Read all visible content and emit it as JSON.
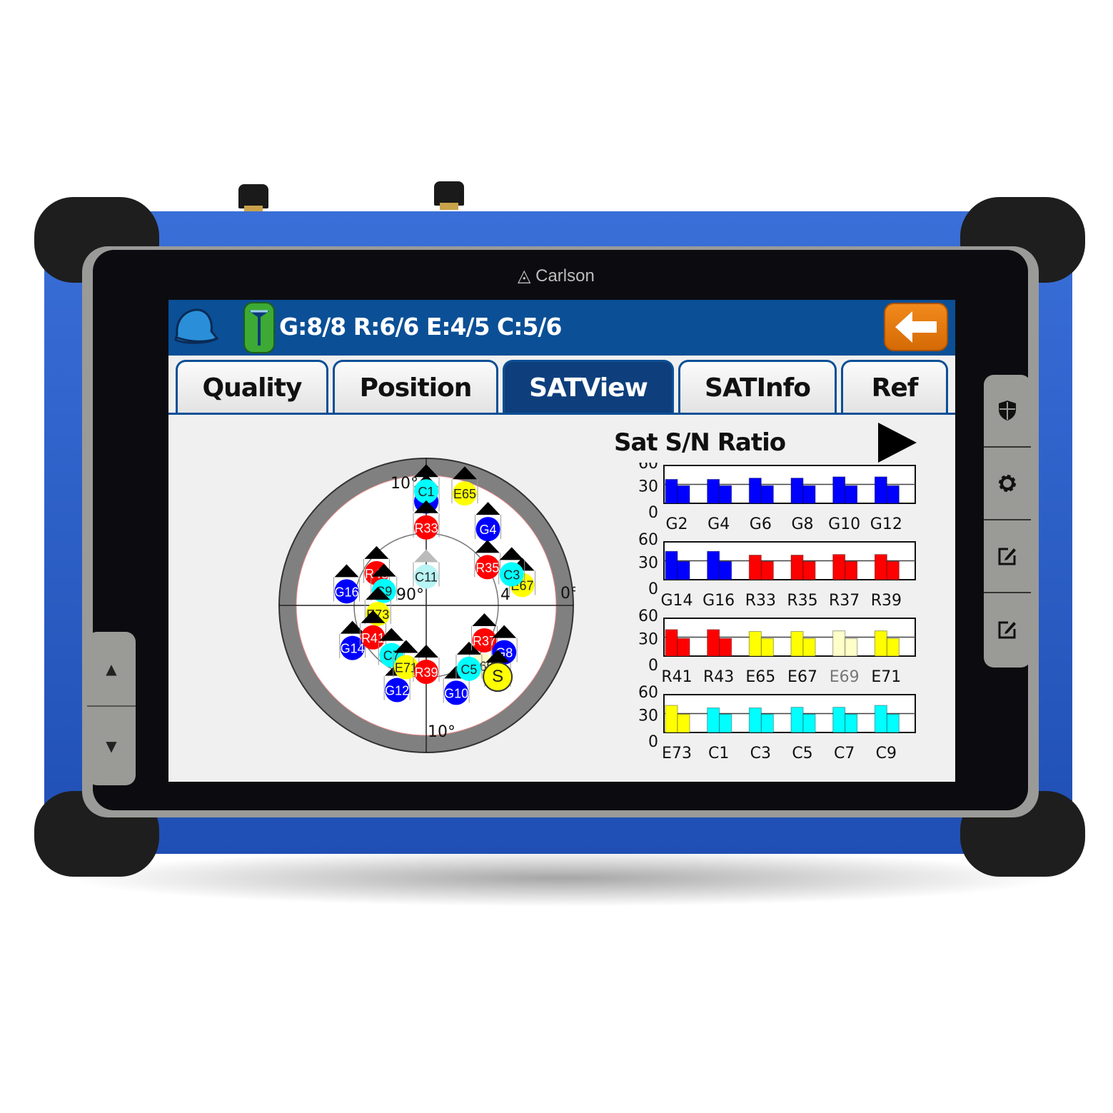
{
  "device": {
    "brand": "Carlson"
  },
  "header": {
    "status_text": "G:8/8 R:6/6 E:4/5 C:5/6",
    "icons": [
      "hard-hat-icon",
      "gnss-antenna-icon",
      "back-arrow-icon"
    ]
  },
  "tabs": [
    {
      "label": "Quality",
      "active": false
    },
    {
      "label": "Position",
      "active": false
    },
    {
      "label": "SATView",
      "active": true
    },
    {
      "label": "SATInfo",
      "active": false
    },
    {
      "label": "Ref",
      "active": false
    }
  ],
  "side_buttons": [
    "shield-icon",
    "gear-icon",
    "edit-1-icon",
    "edit-2-icon"
  ],
  "left_buttons": [
    {
      "label": "▲"
    },
    {
      "label": "▼"
    }
  ],
  "colors": {
    "header": "#0b4f96",
    "gps": "#0000ff",
    "glonass": "#ff0000",
    "galileo": "#ffff00",
    "beidou": "#00ffff",
    "inactive_galileo": "#ffffc8",
    "inactive_beidou": "#b8f4f4",
    "back_button": "#e67a10"
  },
  "skyplot": {
    "labels": {
      "top": "10°",
      "bottom": "10°",
      "center": "90°",
      "right": "0°",
      "inner": "4"
    },
    "satellites": [
      {
        "id": "G2",
        "sys": "gps",
        "az": 0,
        "el": 18,
        "label": ""
      },
      {
        "id": "C1",
        "sys": "beidou",
        "az": 0,
        "el": 11
      },
      {
        "id": "E65",
        "sys": "galileo",
        "az": 19,
        "el": 8
      },
      {
        "id": "R33",
        "sys": "glonass",
        "az": 0,
        "el": 36
      },
      {
        "id": "G4",
        "sys": "gps",
        "az": 39,
        "el": 22
      },
      {
        "id": "C11",
        "sys": "beidou",
        "az": 0,
        "el": 70,
        "inactive": true
      },
      {
        "id": "R35",
        "sys": "glonass",
        "az": 58,
        "el": 40
      },
      {
        "id": "E67",
        "sys": "galileo",
        "az": 78,
        "el": 22
      },
      {
        "id": "C3",
        "sys": "beidou",
        "az": 70,
        "el": 27
      },
      {
        "id": "G16",
        "sys": "gps",
        "az": 280,
        "el": 34
      },
      {
        "id": "R43",
        "sys": "glonass",
        "az": 303,
        "el": 49
      },
      {
        "id": "C9",
        "sys": "beidou",
        "az": 289,
        "el": 59
      },
      {
        "id": "E73",
        "sys": "galileo",
        "az": 260,
        "el": 56
      },
      {
        "id": "G14",
        "sys": "gps",
        "az": 240,
        "el": 31
      },
      {
        "id": "R41",
        "sys": "glonass",
        "az": 239,
        "el": 47
      },
      {
        "id": "G12",
        "sys": "gps",
        "az": 199,
        "el": 28
      },
      {
        "id": "C7",
        "sys": "beidou",
        "az": 215,
        "el": 48
      },
      {
        "id": "E71",
        "sys": "galileo",
        "az": 198,
        "el": 45
      },
      {
        "id": "R39",
        "sys": "glonass",
        "az": 180,
        "el": 44
      },
      {
        "id": "G10",
        "sys": "gps",
        "az": 161,
        "el": 26
      },
      {
        "id": "E69",
        "sys": "galileo",
        "az": 137,
        "el": 33,
        "inactive": true
      },
      {
        "id": "C5",
        "sys": "beidou",
        "az": 146,
        "el": 37
      },
      {
        "id": "R37",
        "sys": "glonass",
        "az": 121,
        "el": 43
      },
      {
        "id": "G8",
        "sys": "gps",
        "az": 121,
        "el": 27
      },
      {
        "id": "S",
        "sys": "galileo",
        "az": 135,
        "el": 20,
        "big": true
      }
    ]
  },
  "chart_data": {
    "type": "bar",
    "title": "Sat S/N Ratio",
    "ylim": [
      0,
      60
    ],
    "yticks": [
      0,
      30,
      60
    ],
    "gridline": 30,
    "panels": [
      {
        "categories": [
          "G2",
          "G4",
          "G6",
          "G8",
          "G10",
          "G12"
        ],
        "sys": [
          "gps",
          "gps",
          "gps",
          "gps",
          "gps",
          "gps"
        ],
        "series": [
          {
            "values": [
              38,
              38,
              40,
              40,
              42,
              42
            ]
          },
          {
            "values": [
              28,
              28,
              28,
              28,
              28,
              28
            ]
          }
        ]
      },
      {
        "categories": [
          "G14",
          "G16",
          "R33",
          "R35",
          "R37",
          "R39"
        ],
        "sys": [
          "gps",
          "gps",
          "glonass",
          "glonass",
          "glonass",
          "glonass"
        ],
        "series": [
          {
            "values": [
              45,
              45,
              39,
              39,
              40,
              40
            ]
          },
          {
            "values": [
              29,
              29,
              29,
              29,
              29,
              29
            ]
          }
        ]
      },
      {
        "categories": [
          "R41",
          "R43",
          "E65",
          "E67",
          "E69",
          "E71"
        ],
        "sys": [
          "glonass",
          "glonass",
          "galileo",
          "galileo",
          "inactive_galileo",
          "galileo"
        ],
        "series": [
          {
            "values": [
              42,
              42,
              39,
              39,
              40,
              40
            ]
          },
          {
            "values": [
              28,
              28,
              28,
              28,
              28,
              28
            ]
          }
        ]
      },
      {
        "categories": [
          "E73",
          "C1",
          "C3",
          "C5",
          "C7",
          "C9"
        ],
        "sys": [
          "galileo",
          "beidou",
          "beidou",
          "beidou",
          "beidou",
          "beidou"
        ],
        "series": [
          {
            "values": [
              43,
              39,
              39,
              40,
              40,
              43
            ]
          },
          {
            "values": [
              29,
              29,
              29,
              29,
              29,
              29
            ]
          }
        ]
      }
    ]
  }
}
